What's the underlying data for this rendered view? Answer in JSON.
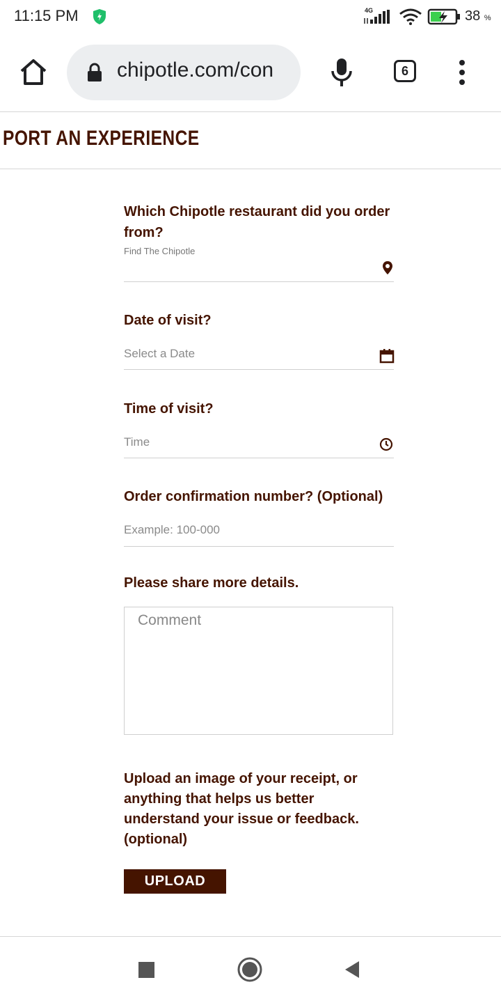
{
  "status_bar": {
    "time": "11:15 PM",
    "network_type": "4G",
    "battery_percent": "38",
    "battery_unit": "%"
  },
  "browser": {
    "url": "chipotle.com/con",
    "tab_count": "6"
  },
  "page": {
    "heading": "PORT AN EXPERIENCE"
  },
  "form": {
    "restaurant": {
      "label": "Which Chipotle restaurant did you order from?",
      "hint": "Find The Chipotle"
    },
    "date": {
      "label": "Date of visit?",
      "placeholder": "Select a Date"
    },
    "time": {
      "label": "Time of visit?",
      "placeholder": "Time"
    },
    "order_number": {
      "label": "Order confirmation number? (Optional)",
      "placeholder": "Example: 100-000"
    },
    "details": {
      "label": "Please share more details.",
      "placeholder": "Comment"
    },
    "upload": {
      "label": "Upload an image of your receipt, or anything that helps us better understand your issue or feedback. (optional)",
      "button": "UPLOAD"
    }
  },
  "icons": {
    "status": [
      "shield-icon",
      "signal-icon",
      "wifi-icon",
      "battery-charging-icon"
    ],
    "toolbar": [
      "home-icon",
      "lock-icon",
      "mic-icon",
      "tabs-icon",
      "more-vert-icon"
    ],
    "fields": [
      "location-pin-icon",
      "calendar-icon",
      "clock-icon"
    ],
    "navigation": [
      "recents-icon",
      "home-circle-icon",
      "back-icon"
    ]
  },
  "colors": {
    "brand_brown": "#451400",
    "shield_green": "#1fbf6a",
    "battery_green": "#3ccf4e"
  }
}
